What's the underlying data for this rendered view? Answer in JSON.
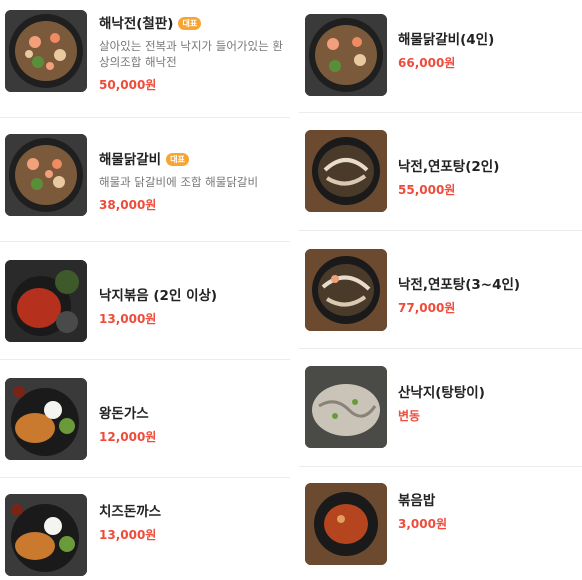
{
  "left": [
    {
      "name": "해낙전(철판)",
      "badge": "대표",
      "desc": "살아있는 전복과 낙지가 들어가있는 환상의조합 해낙전",
      "price": "50,000원",
      "image": "seafood-pan"
    },
    {
      "name": "해물닭갈비",
      "badge": "대표",
      "desc": "해물과 닭갈비에 조합 해물닭갈비",
      "price": "38,000원",
      "image": "seafood-pan"
    },
    {
      "name": "낙지볶음 (2인 이상)",
      "badge": "",
      "desc": "",
      "price": "13,000원",
      "image": "stir-fry"
    },
    {
      "name": "왕돈가스",
      "badge": "",
      "desc": "",
      "price": "12,000원",
      "image": "cutlet"
    },
    {
      "name": "치즈돈까스",
      "badge": "",
      "desc": "",
      "price": "13,000원",
      "image": "cutlet"
    }
  ],
  "right": [
    {
      "name": "해물닭갈비(4인)",
      "price": "66,000원",
      "image": "seafood-pan"
    },
    {
      "name": "낙전,연포탕(2인)",
      "price": "55,000원",
      "image": "octopus-pan"
    },
    {
      "name": "낙전,연포탕(3~4인)",
      "price": "77,000원",
      "image": "octopus-pan"
    },
    {
      "name": "산낙지(탕탕이)",
      "price": "변동",
      "image": "raw-octopus"
    },
    {
      "name": "볶음밥",
      "price": "3,000원",
      "image": "fried-rice"
    }
  ]
}
